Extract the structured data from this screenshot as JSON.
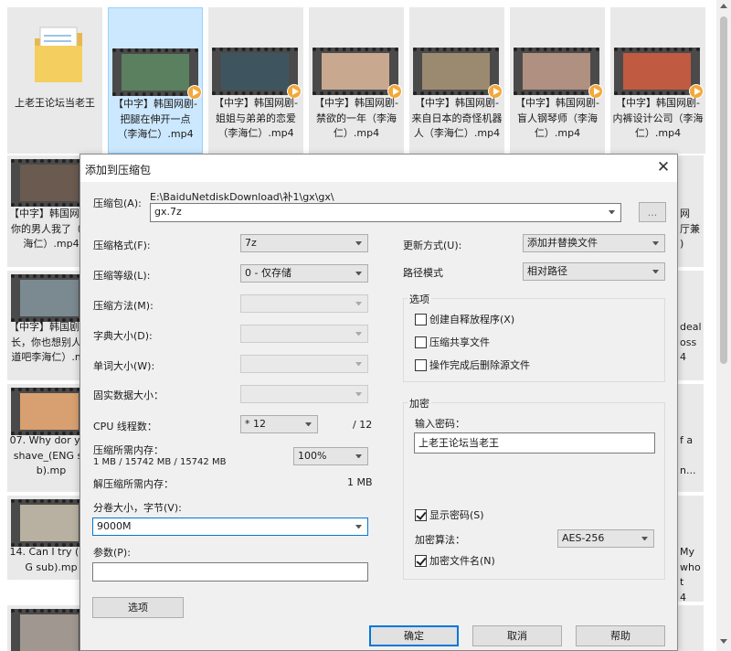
{
  "explorer": {
    "row1": [
      {
        "caption": "上老王论坛当老王",
        "type": "folder"
      },
      {
        "caption": "【中字】韩国网剧-把腿在伸开一点（李海仁）.mp4",
        "type": "video",
        "selected": true
      },
      {
        "caption": "【中字】韩国网剧-姐姐与弟弟的恋爱（李海仁）.mp4",
        "type": "video"
      },
      {
        "caption": "【中字】韩国网剧-禁欲的一年（李海仁）.mp4",
        "type": "video"
      },
      {
        "caption": "【中字】韩国网剧-来自日本的奇怪机器人（李海仁）.mp4",
        "type": "video"
      },
      {
        "caption": "【中字】韩国网剧-盲人钢琴师（李海仁）.mp4",
        "type": "video"
      },
      {
        "caption": "【中字】韩国网剧-内裤设计公司（李海仁）.mp4",
        "type": "video"
      }
    ],
    "left_col": [
      {
        "caption": "【中字】韩国网剧-你的男人我了（李海仁）.mp4"
      },
      {
        "caption": "【中字】韩国剧-组长，你也想别人知道吧李海仁）.mp"
      },
      {
        "caption": "07. Why dor you shave_(ENG sub).mp"
      },
      {
        "caption": "14. Can I try (ENG sub).mp"
      }
    ],
    "right_col": [
      {
        "caption": "网\n厅兼\n)"
      },
      {
        "caption": "deal\noss\n4"
      },
      {
        "caption": "f a\n\nn..."
      },
      {
        "caption": "My\nwho\nt\n4"
      }
    ]
  },
  "dialog": {
    "title": "添加到压缩包",
    "close": "✕",
    "archive_label": "压缩包(A):",
    "archive_path": "E:\\BaiduNetdiskDownload\\补1\\gx\\gx\\",
    "archive_name": "gx.7z",
    "browse_label": "...",
    "format_label": "压缩格式(F):",
    "format_value": "7z",
    "level_label": "压缩等级(L):",
    "level_value": "0 - 仅存储",
    "method_label": "压缩方法(M):",
    "dict_label": "字典大小(D):",
    "word_label": "单词大小(W):",
    "solid_label": "固实数据大小：",
    "threads_label": "CPU 线程数：",
    "threads_value": "* 12",
    "threads_max": "/ 12",
    "mem_compress_label": "压缩所需内存：",
    "mem_compress_value": "1 MB / 15742 MB / 15742 MB",
    "mem_percent": "100%",
    "mem_decompress_label": "解压缩所需内存：",
    "mem_decompress_value": "1 MB",
    "volume_label": "分卷大小，字节(V):",
    "volume_value": "9000M",
    "params_label": "参数(P):",
    "params_value": "",
    "options_button": "选项",
    "update_label": "更新方式(U):",
    "update_value": "添加并替换文件",
    "path_label": "路径模式",
    "path_value": "相对路径",
    "options_group": "选项",
    "opt_sfx": "创建自释放程序(X)",
    "opt_shared": "压缩共享文件",
    "opt_delete": "操作完成后删除源文件",
    "encrypt_group": "加密",
    "password_label": "输入密码：",
    "password_value": "上老王论坛当老王",
    "show_password": "显示密码(S)",
    "enc_method_label": "加密算法：",
    "enc_method_value": "AES-256",
    "enc_names": "加密文件名(N)",
    "ok": "确定",
    "cancel": "取消",
    "help": "帮助"
  }
}
